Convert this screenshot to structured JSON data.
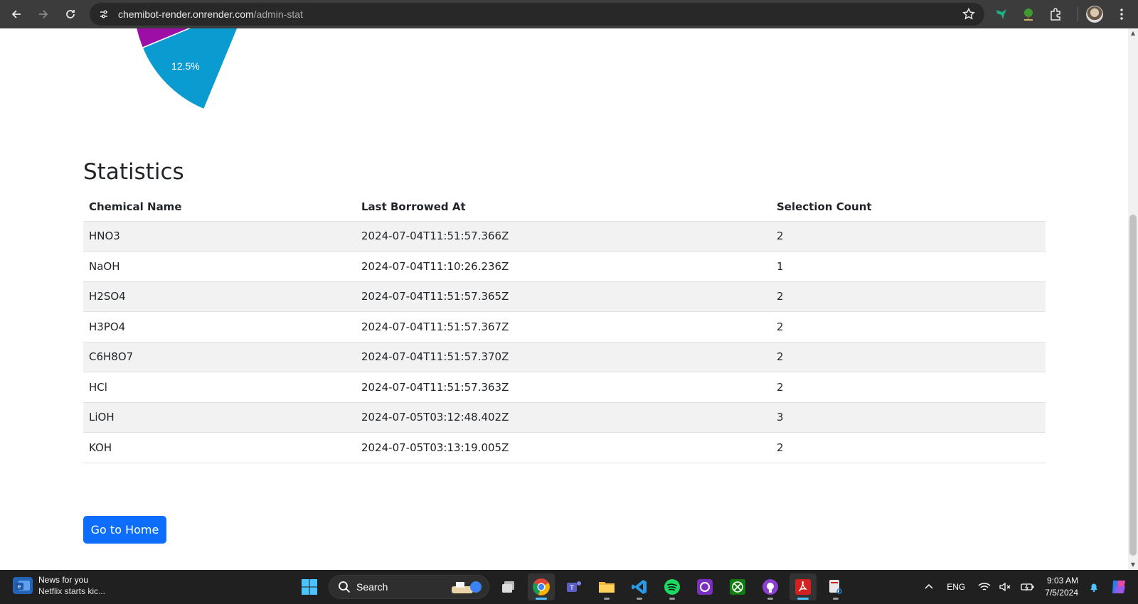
{
  "browser": {
    "url_host": "chemibot-render.onrender.com",
    "url_path": "/admin-stat"
  },
  "chart_data": {
    "type": "pie",
    "slices": [
      {
        "label": "12.5%",
        "value": 12.5,
        "color": "#0a9bd0"
      },
      {
        "label": "12.5%",
        "value": 12.5,
        "color": "#9c0ea6"
      },
      {
        "label": "12.5%",
        "value": 12.5,
        "color": "#1e9b1e"
      }
    ]
  },
  "statistics": {
    "title": "Statistics",
    "headers": [
      "Chemical Name",
      "Last Borrowed At",
      "Selection Count"
    ],
    "rows": [
      [
        "HNO3",
        "2024-07-04T11:51:57.366Z",
        "2"
      ],
      [
        "NaOH",
        "2024-07-04T11:10:26.236Z",
        "1"
      ],
      [
        "H2SO4",
        "2024-07-04T11:51:57.365Z",
        "2"
      ],
      [
        "H3PO4",
        "2024-07-04T11:51:57.367Z",
        "2"
      ],
      [
        "C6H8O7",
        "2024-07-04T11:51:57.370Z",
        "2"
      ],
      [
        "HCl",
        "2024-07-04T11:51:57.363Z",
        "2"
      ],
      [
        "LiOH",
        "2024-07-05T03:12:48.402Z",
        "3"
      ],
      [
        "KOH",
        "2024-07-05T03:13:19.005Z",
        "2"
      ]
    ]
  },
  "home_button": "Go to Home",
  "taskbar": {
    "news_title": "News for you",
    "news_sub": "Netflix starts kic...",
    "search_label": "Search",
    "lang": "ENG",
    "time": "9:03 AM",
    "date": "7/5/2024"
  },
  "colors": {
    "accent": "#0d6efd"
  }
}
